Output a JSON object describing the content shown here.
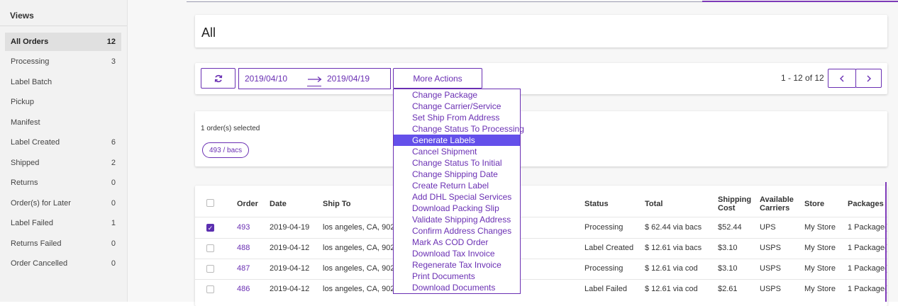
{
  "sidebar": {
    "title": "Views",
    "items": [
      {
        "label": "All Orders",
        "count": "12",
        "active": true
      },
      {
        "label": "Processing",
        "count": "3"
      },
      {
        "label": "Label Batch",
        "count": ""
      },
      {
        "label": "Pickup",
        "count": ""
      },
      {
        "label": "Manifest",
        "count": ""
      },
      {
        "label": "Label Created",
        "count": "6"
      },
      {
        "label": "Shipped",
        "count": "2"
      },
      {
        "label": "Returns",
        "count": "0"
      },
      {
        "label": "Order(s) for Later",
        "count": "0"
      },
      {
        "label": "Label Failed",
        "count": "1"
      },
      {
        "label": "Returns Failed",
        "count": "0"
      },
      {
        "label": "Order Cancelled",
        "count": "0"
      }
    ]
  },
  "header": {
    "title": "All"
  },
  "toolbar": {
    "date_from": "2019/04/10",
    "date_to": "2019/04/19",
    "more_actions_label": "More Actions",
    "pager_text": "1 - 12 of 12"
  },
  "selection": {
    "text": "1 order(s) selected",
    "tag": "493 / bacs"
  },
  "dropdown": {
    "items": [
      "Change Package",
      "Change Carrier/Service",
      "Set Ship From Address",
      "Change Status To Processing",
      "Generate Labels",
      "Cancel Shipment",
      "Change Status To Initial",
      "Change Shipping Date",
      "Create Return Label",
      "Add DHL Special Services",
      "Download Packing Slip",
      "Validate Shipping Address",
      "Confirm Address Changes",
      "Mark As COD Order",
      "Download Tax Invoice",
      "Regenerate Tax Invoice",
      "Print Documents",
      "Download Documents"
    ],
    "highlighted": "Generate Labels"
  },
  "table": {
    "headers": {
      "order": "Order",
      "date": "Date",
      "ship_to": "Ship To",
      "status": "Status",
      "total": "Total",
      "shipping_cost_1": "Shipping",
      "shipping_cost_2": "Cost",
      "carriers_1": "Available",
      "carriers_2": "Carriers",
      "store": "Store",
      "packages": "Packages"
    },
    "rows": [
      {
        "order": "493",
        "date": "2019-04-19",
        "ship_to": "los angeles, CA, 902",
        "status": "Processing",
        "total": "$ 62.44 via bacs",
        "shipping_cost": "$52.44",
        "carriers": "UPS",
        "store": "My Store",
        "packages": "1 Package(",
        "checked": true
      },
      {
        "order": "488",
        "date": "2019-04-12",
        "ship_to": "los angeles, CA, 902",
        "status": "Label Created",
        "total": "$ 12.61 via bacs",
        "shipping_cost": "$3.10",
        "carriers": "USPS",
        "store": "My Store",
        "packages": "1 Package(",
        "checked": false
      },
      {
        "order": "487",
        "date": "2019-04-12",
        "ship_to": "los angeles, CA, 902",
        "status": "Processing",
        "total": "$ 12.61 via cod",
        "shipping_cost": "$3.10",
        "carriers": "USPS",
        "store": "My Store",
        "packages": "1 Package(",
        "checked": false
      },
      {
        "order": "486",
        "date": "2019-04-12",
        "ship_to": "los angeles, CA, 902",
        "status": "Label Failed",
        "total": "$ 12.61 via cod",
        "shipping_cost": "$2.61",
        "carriers": "USPS",
        "store": "My Store",
        "packages": "1 Package(",
        "checked": false
      }
    ]
  },
  "icons": {
    "refresh": "refresh-icon",
    "arrow": "arrow-right-icon",
    "prev": "chevron-left-icon",
    "next": "chevron-right-icon"
  },
  "colors": {
    "accent": "#6a2fb3",
    "highlight": "#6450ea"
  }
}
